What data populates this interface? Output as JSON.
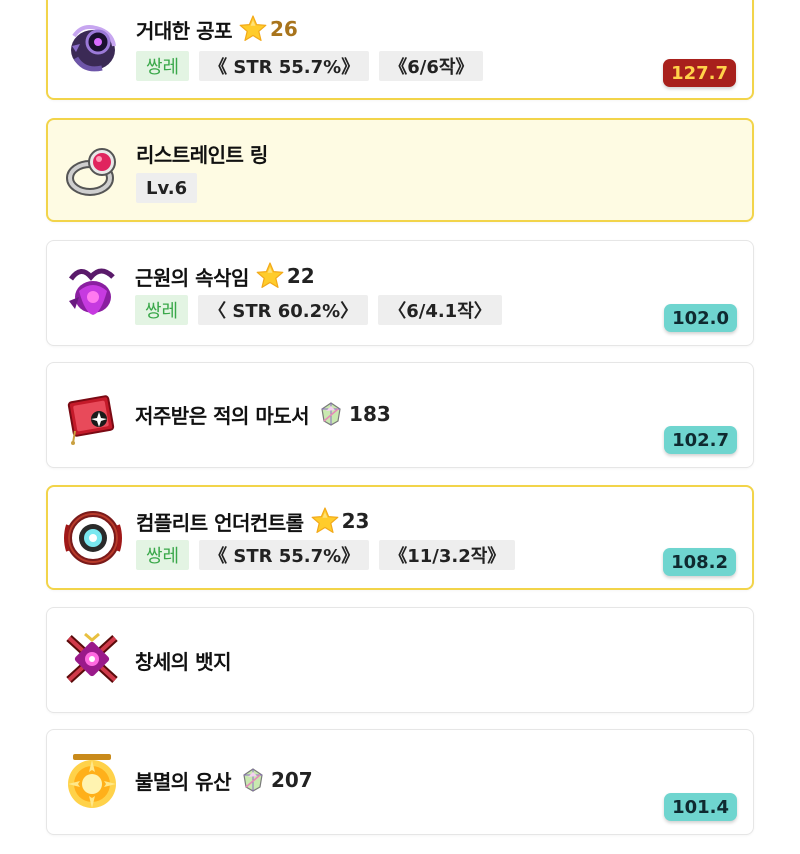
{
  "items": [
    {
      "name": "거대한 공포",
      "star_level": "26",
      "icon": "dark-pendant-icon",
      "tags": [
        "쌍레",
        "《 STR 55.7%》",
        "《6/6작》"
      ],
      "score": "127.7"
    },
    {
      "name": "리스트레인트 링",
      "icon": "ruby-ring-icon",
      "tags": [
        "Lv.6"
      ]
    },
    {
      "name": "근원의 속삭임",
      "star_level": "22",
      "icon": "purple-pendant-icon",
      "tags": [
        "쌍레",
        "〈 STR 60.2%〉",
        "〈6/4.1작〉"
      ],
      "score": "102.0"
    },
    {
      "name": "저주받은 적의 마도서",
      "gem_count": "183",
      "icon": "cursed-grimoire-icon",
      "score": "102.7"
    },
    {
      "name": "컴플리트 언더컨트롤",
      "star_level": "23",
      "icon": "complete-undercontrol-icon",
      "tags": [
        "쌍레",
        "《 STR 55.7%》",
        "《11/3.2작》"
      ],
      "score": "108.2"
    },
    {
      "name": "창세의 뱃지",
      "icon": "genesis-badge-icon"
    },
    {
      "name": "불멸의 유산",
      "gem_count": "207",
      "icon": "immortal-legacy-icon",
      "score": "101.4"
    }
  ],
  "colors": {
    "gold_border": "#f2d44a",
    "highlight_bg": "#fefbe3",
    "score_red": "#a8201c",
    "score_teal": "#6fd5cf",
    "tag_green": "#3aa84a",
    "star_level_gold": "#a8741c"
  }
}
